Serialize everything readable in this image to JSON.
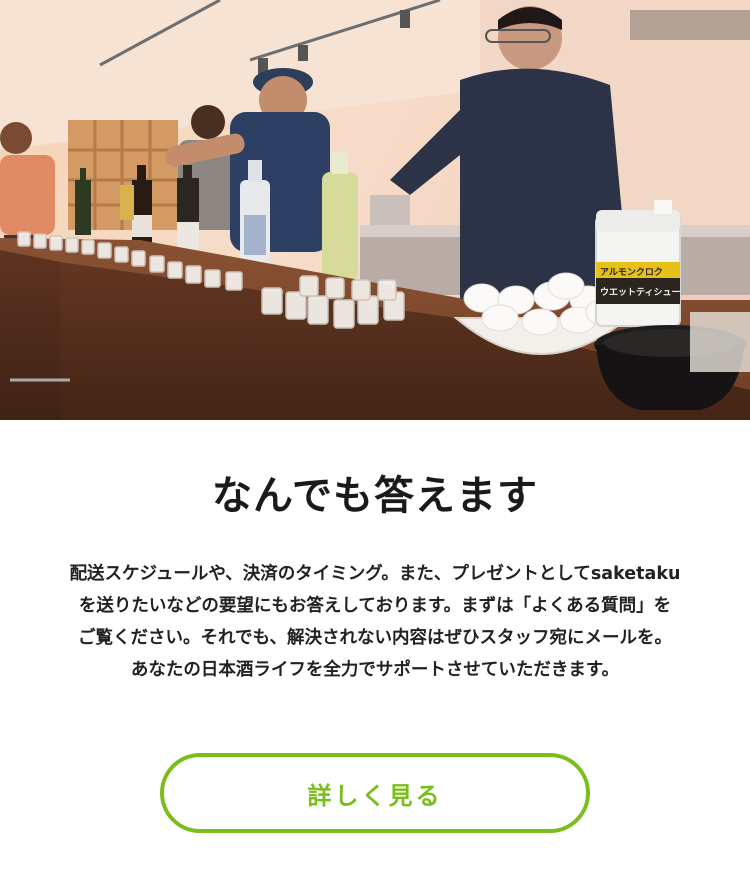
{
  "hero": {
    "photo": "staff-at-sake-tasting-counter",
    "tissue_label_1": "アルモンクロク",
    "tissue_label_2": "ウエットティシュー"
  },
  "section": {
    "title": "なんでも答えます",
    "description_lines": [
      "配送スケジュールや、決済のタイミング。また、プレゼントとしてsaketaku",
      "を送りたいなどの要望にもお答えしております。まずは「よくある質問」を",
      "ご覧ください。それでも、解決されない内容はぜひスタッフ宛にメールを。",
      "あなたの日本酒ライフを全力でサポートさせていただきます。"
    ],
    "button_label": "詳しく見る"
  },
  "colors": {
    "accent": "#7cbd1e",
    "text": "#222222",
    "background": "#ffffff"
  }
}
